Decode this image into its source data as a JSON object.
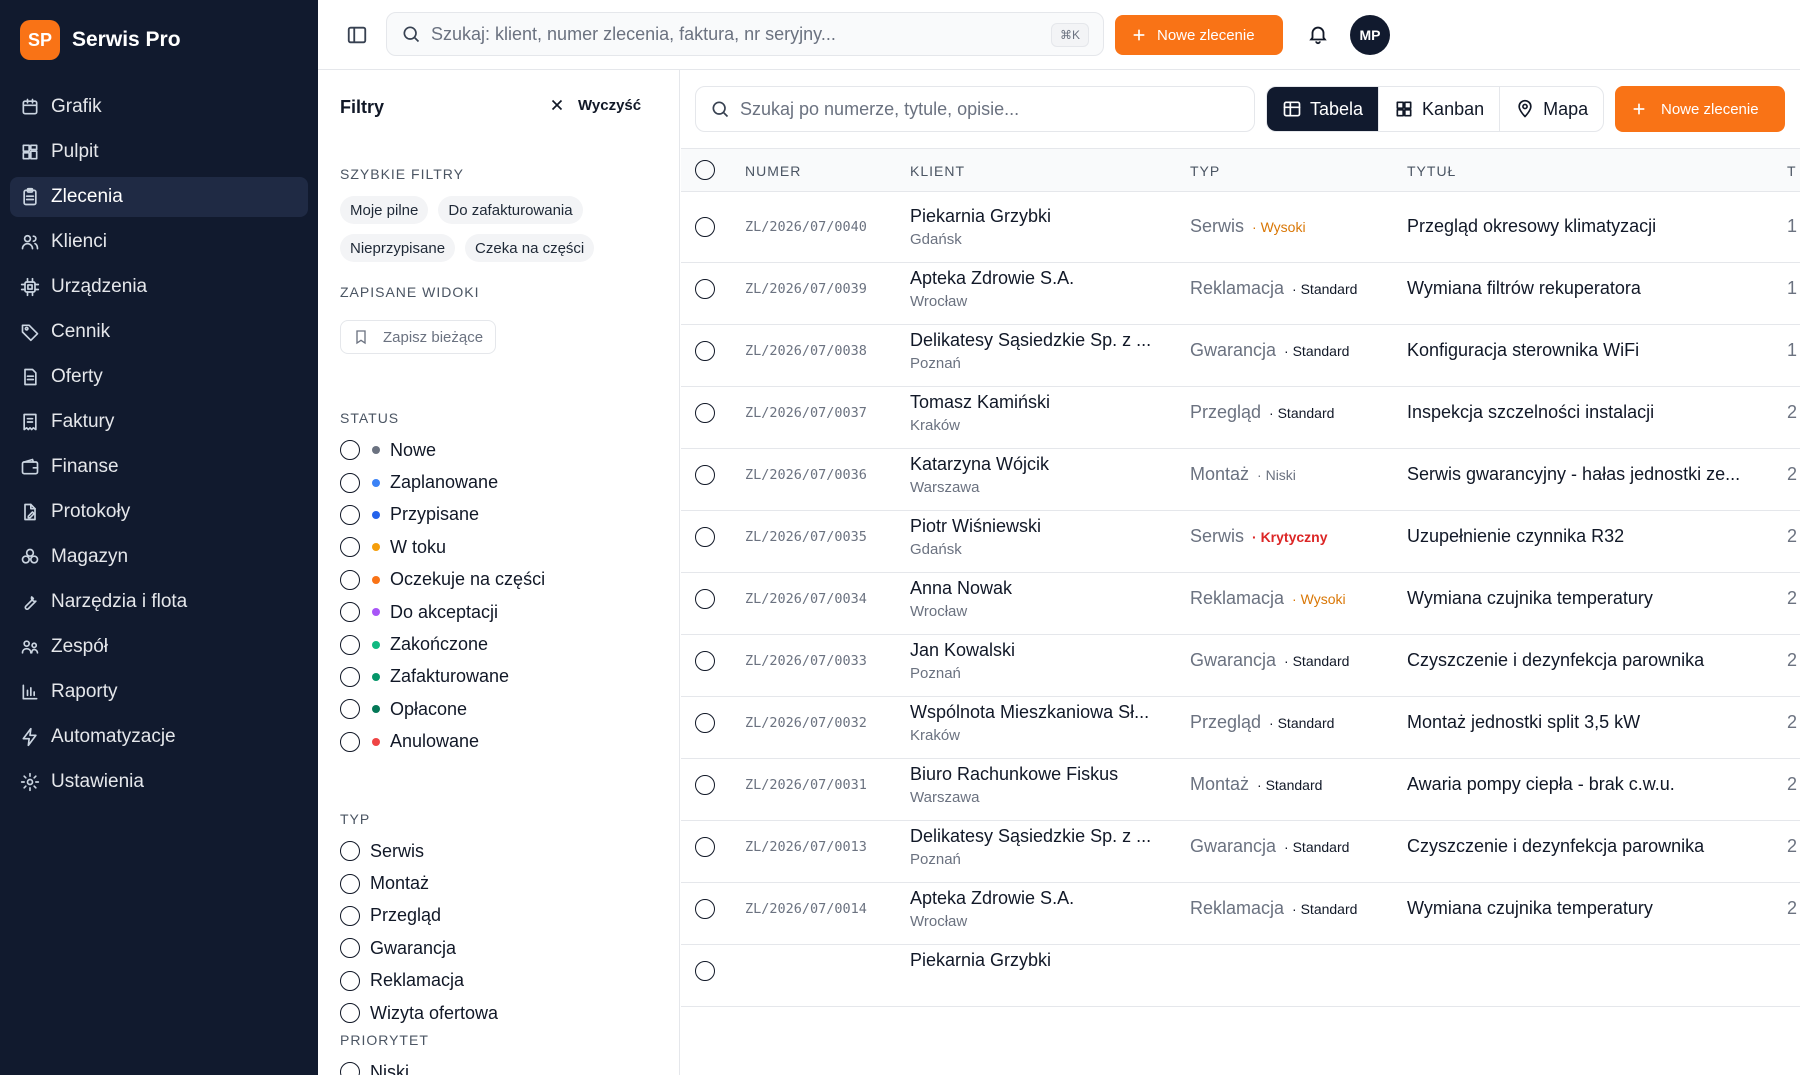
{
  "brand": {
    "logo": "SP",
    "name": "Serwis Pro"
  },
  "sidebar": {
    "items": [
      {
        "label": "Grafik",
        "icon": "calendar-icon",
        "active": false
      },
      {
        "label": "Pulpit",
        "icon": "dashboard-icon",
        "active": false
      },
      {
        "label": "Zlecenia",
        "icon": "clipboard-icon",
        "active": true
      },
      {
        "label": "Klienci",
        "icon": "users-icon",
        "active": false
      },
      {
        "label": "Urządzenia",
        "icon": "cpu-icon",
        "active": false
      },
      {
        "label": "Cennik",
        "icon": "tag-icon",
        "active": false
      },
      {
        "label": "Oferty",
        "icon": "document-icon",
        "active": false
      },
      {
        "label": "Faktury",
        "icon": "invoice-icon",
        "active": false
      },
      {
        "label": "Finanse",
        "icon": "wallet-icon",
        "active": false
      },
      {
        "label": "Protokoły",
        "icon": "file-edit-icon",
        "active": false
      },
      {
        "label": "Magazyn",
        "icon": "boxes-icon",
        "active": false
      },
      {
        "label": "Narzędzia i flota",
        "icon": "wrench-icon",
        "active": false
      },
      {
        "label": "Zespół",
        "icon": "team-icon",
        "active": false
      },
      {
        "label": "Raporty",
        "icon": "bar-chart-icon",
        "active": false
      },
      {
        "label": "Automatyzacje",
        "icon": "zap-icon",
        "active": false
      },
      {
        "label": "Ustawienia",
        "icon": "gear-icon",
        "active": false
      }
    ]
  },
  "topbar": {
    "search_placeholder": "Szukaj: klient, numer zlecenia, faktura, nr seryjny...",
    "shortcut": "⌘K",
    "new_order_label": "Nowe zlecenie",
    "avatar_initials": "MP"
  },
  "filters": {
    "title": "Filtry",
    "clear_label": "Wyczyść",
    "quick_label": "SZYBKIE FILTRY",
    "quick": [
      "Moje pilne",
      "Do zafakturowania",
      "Nieprzypisane",
      "Czeka na części"
    ],
    "saved_label": "ZAPISANE WIDOKI",
    "save_current": "Zapisz bieżące",
    "status_label": "STATUS",
    "statuses": [
      {
        "label": "Nowe",
        "color": "#6b7280"
      },
      {
        "label": "Zaplanowane",
        "color": "#3b82f6"
      },
      {
        "label": "Przypisane",
        "color": "#2563eb"
      },
      {
        "label": "W toku",
        "color": "#f59e0b"
      },
      {
        "label": "Oczekuje na części",
        "color": "#f97316"
      },
      {
        "label": "Do akceptacji",
        "color": "#a855f7"
      },
      {
        "label": "Zakończone",
        "color": "#10b981"
      },
      {
        "label": "Zafakturowane",
        "color": "#059669"
      },
      {
        "label": "Opłacone",
        "color": "#047857"
      },
      {
        "label": "Anulowane",
        "color": "#ef4444"
      }
    ],
    "type_label": "TYP",
    "types": [
      "Serwis",
      "Montaż",
      "Przegląd",
      "Gwarancja",
      "Reklamacja",
      "Wizyta ofertowa"
    ],
    "priority_label": "PRIORYTET",
    "priorities": [
      "Niski"
    ]
  },
  "main": {
    "search_placeholder": "Szukaj po numerze, tytule, opisie...",
    "views": [
      {
        "label": "Tabela",
        "icon": "table-icon",
        "active": true
      },
      {
        "label": "Kanban",
        "icon": "kanban-icon",
        "active": false
      },
      {
        "label": "Mapa",
        "icon": "map-pin-icon",
        "active": false
      }
    ],
    "new_order_label": "Nowe zlecenie",
    "columns": {
      "number": "NUMER",
      "client": "KLIENT",
      "type": "TYP",
      "title": "TYTUŁ",
      "next": "T"
    },
    "rows": [
      {
        "number": "ZL/2026/07/0040",
        "client": "Piekarnia Grzybki",
        "city": "Gdańsk",
        "type": "Serwis",
        "priority": "Wysoki",
        "level": "high",
        "title": "Przegląd okresowy klimatyzacji",
        "next": "1"
      },
      {
        "number": "ZL/2026/07/0039",
        "client": "Apteka Zdrowie S.A.",
        "city": "Wrocław",
        "type": "Reklamacja",
        "priority": "Standard",
        "level": "std",
        "title": "Wymiana filtrów rekuperatora",
        "next": "1"
      },
      {
        "number": "ZL/2026/07/0038",
        "client": "Delikatesy Sąsiedzkie Sp. z ...",
        "city": "Poznań",
        "type": "Gwarancja",
        "priority": "Standard",
        "level": "std",
        "title": "Konfiguracja sterownika WiFi",
        "next": "1"
      },
      {
        "number": "ZL/2026/07/0037",
        "client": "Tomasz Kamiński",
        "city": "Kraków",
        "type": "Przegląd",
        "priority": "Standard",
        "level": "std",
        "title": "Inspekcja szczelności instalacji",
        "next": "2"
      },
      {
        "number": "ZL/2026/07/0036",
        "client": "Katarzyna Wójcik",
        "city": "Warszawa",
        "type": "Montaż",
        "priority": "Niski",
        "level": "low",
        "title": "Serwis gwarancyjny - hałas jednostki ze...",
        "next": "2"
      },
      {
        "number": "ZL/2026/07/0035",
        "client": "Piotr Wiśniewski",
        "city": "Gdańsk",
        "type": "Serwis",
        "priority": "Krytyczny",
        "level": "crit",
        "title": "Uzupełnienie czynnika R32",
        "next": "2"
      },
      {
        "number": "ZL/2026/07/0034",
        "client": "Anna Nowak",
        "city": "Wrocław",
        "type": "Reklamacja",
        "priority": "Wysoki",
        "level": "high",
        "title": "Wymiana czujnika temperatury",
        "next": "2"
      },
      {
        "number": "ZL/2026/07/0033",
        "client": "Jan Kowalski",
        "city": "Poznań",
        "type": "Gwarancja",
        "priority": "Standard",
        "level": "std",
        "title": "Czyszczenie i dezynfekcja parownika",
        "next": "2"
      },
      {
        "number": "ZL/2026/07/0032",
        "client": "Wspólnota Mieszkaniowa Sł...",
        "city": "Kraków",
        "type": "Przegląd",
        "priority": "Standard",
        "level": "std",
        "title": "Montaż jednostki split 3,5 kW",
        "next": "2"
      },
      {
        "number": "ZL/2026/07/0031",
        "client": "Biuro Rachunkowe Fiskus",
        "city": "Warszawa",
        "type": "Montaż",
        "priority": "Standard",
        "level": "std",
        "title": "Awaria pompy ciepła - brak c.w.u.",
        "next": "2"
      },
      {
        "number": "ZL/2026/07/0013",
        "client": "Delikatesy Sąsiedzkie Sp. z ...",
        "city": "Poznań",
        "type": "Gwarancja",
        "priority": "Standard",
        "level": "std",
        "title": "Czyszczenie i dezynfekcja parownika",
        "next": "2"
      },
      {
        "number": "ZL/2026/07/0014",
        "client": "Apteka Zdrowie S.A.",
        "city": "Wrocław",
        "type": "Reklamacja",
        "priority": "Standard",
        "level": "std",
        "title": "Wymiana czujnika temperatury",
        "next": "2"
      },
      {
        "number": "",
        "client": "Piekarnia Grzybki",
        "city": "",
        "type": "",
        "priority": "",
        "level": "std",
        "title": "",
        "next": ""
      }
    ]
  }
}
